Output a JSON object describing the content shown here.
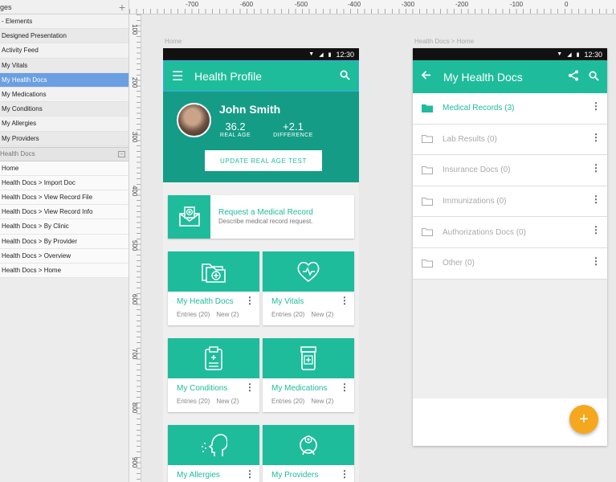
{
  "pages_panel": {
    "header": "ges",
    "items": [
      {
        "label": "- Elements"
      },
      {
        "label": "Designed Presentation"
      },
      {
        "label": "Activity Feed"
      },
      {
        "label": "My Vitals"
      },
      {
        "label": "My Health Docs"
      },
      {
        "label": "My Medications"
      },
      {
        "label": "My Conditions"
      },
      {
        "label": "My Allergies"
      },
      {
        "label": "My Providers"
      }
    ],
    "group_label": "Health Docs",
    "sub_items": [
      {
        "label": "Home"
      },
      {
        "label": "Health Docs > Import Doc"
      },
      {
        "label": "Health Docs > View Record File"
      },
      {
        "label": "Health Docs > View Record Info"
      },
      {
        "label": "Health Docs > By Clinic"
      },
      {
        "label": "Health Docs > By Provider"
      },
      {
        "label": "Health Docs > Overview"
      },
      {
        "label": "Health Docs > Home"
      }
    ]
  },
  "ruler": {
    "top": [
      "-700",
      "-600",
      "-500",
      "-400",
      "-300",
      "-200",
      "-100",
      "0"
    ],
    "left": [
      "100",
      "200",
      "300",
      "400",
      "500",
      "600",
      "700",
      "800",
      "900"
    ]
  },
  "artboard1": {
    "label": "Home",
    "status_time": "12:30",
    "appbar_title": "Health Profile",
    "profile": {
      "name": "John Smith",
      "real_age_value": "36.2",
      "real_age_label": "REAL AGE",
      "difference_value": "+2.1",
      "difference_label": "DIFFERENCE",
      "button_label": "UPDATE REAL AGE TEST"
    },
    "request_card": {
      "title": "Request a Medical Record",
      "subtitle": "Describe medical record request."
    },
    "tiles": [
      {
        "title": "My Health Docs",
        "entries": "Entries (20)",
        "new": "New (2)"
      },
      {
        "title": "My Vitals",
        "entries": "Entries (20)",
        "new": "New (2)"
      },
      {
        "title": "My Conditions",
        "entries": "Entries (20)",
        "new": "New (2)"
      },
      {
        "title": "My Medications",
        "entries": "Entries (20)",
        "new": "New (2)"
      },
      {
        "title": "My Allergies"
      },
      {
        "title": "My Providers"
      }
    ]
  },
  "artboard2": {
    "label": "Health Docs > Home",
    "status_time": "12:30",
    "appbar_title": "My Health Docs",
    "folders": [
      {
        "label": "Medical Records (3)"
      },
      {
        "label": "Lab Results (0)"
      },
      {
        "label": "Insurance Docs (0)"
      },
      {
        "label": "Immunizations (0)"
      },
      {
        "label": "Authorizations Docs (0)"
      },
      {
        "label": "Other (0)"
      }
    ],
    "fab_label": "+"
  },
  "colors": {
    "accent": "#1fbc9c",
    "accent_dark": "#149c86",
    "selection": "#6b9fe2",
    "fab": "#f5a81e"
  },
  "icons": [
    "hamburger-menu-icon",
    "search-icon",
    "back-arrow-icon",
    "share-icon",
    "folder-icon",
    "more-vert-icon",
    "add-icon"
  ]
}
